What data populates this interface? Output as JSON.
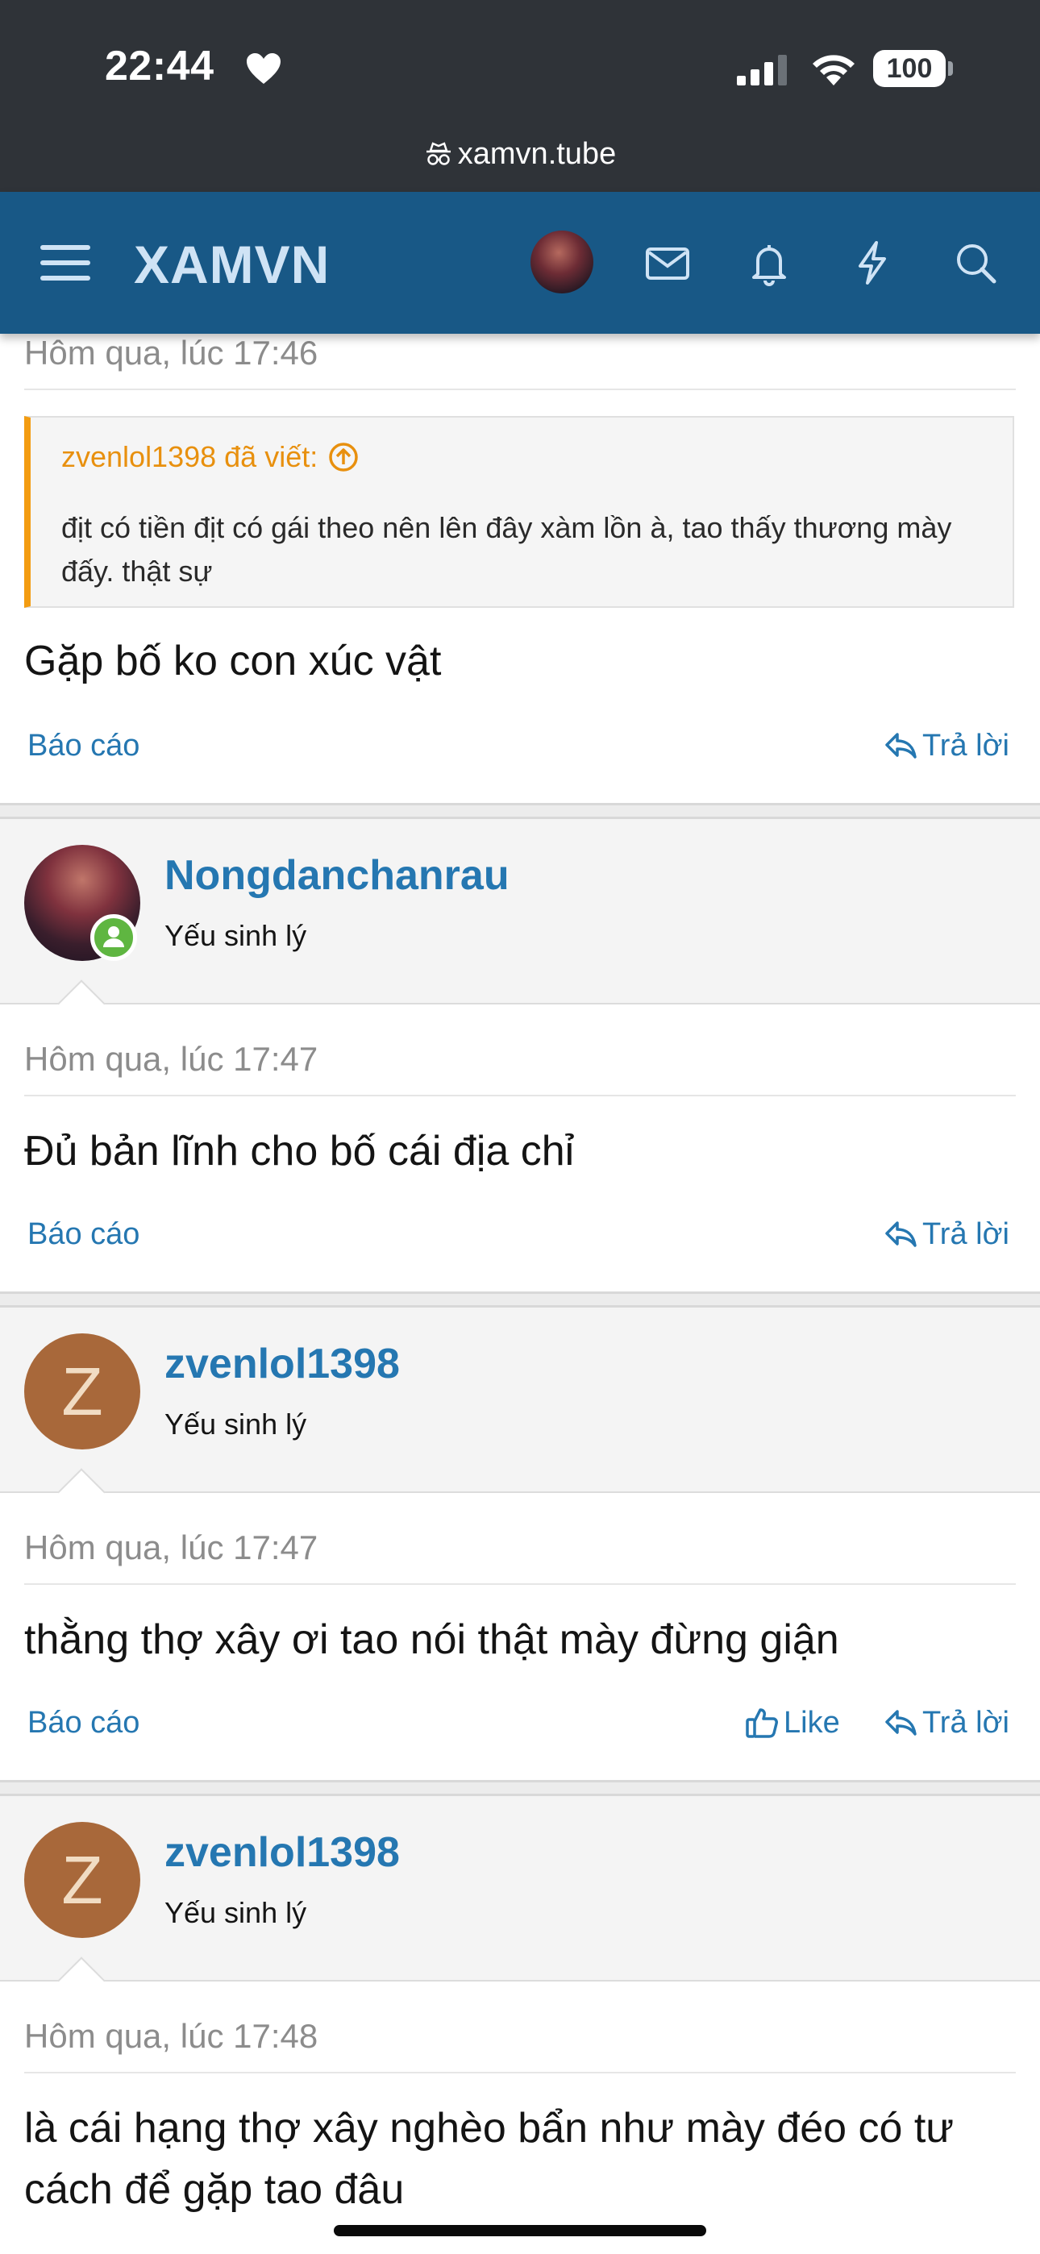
{
  "status_bar": {
    "time": "22:44",
    "battery": "100",
    "url": "xamvn.tube",
    "icons": [
      "heart-icon",
      "signal-icon",
      "wifi-icon",
      "battery-icon",
      "private-browsing-icon"
    ]
  },
  "nav": {
    "logo": "XAMVN",
    "icons": [
      "menu-icon",
      "mail-icon",
      "bell-icon",
      "lightning-icon",
      "search-icon"
    ]
  },
  "colors": {
    "nav_bg": "#185886",
    "link": "#2577b1",
    "quote_accent": "#f39c12",
    "online": "#5fb641"
  },
  "posts": [
    {
      "time": "Hôm qua, lúc 17:46",
      "quote": {
        "author": "zvenlol1398 đã viết:",
        "text": "địt có tiền địt có gái theo nên lên đây xàm lồn à, tao thấy thương mày đấy. thật sự"
      },
      "body": "Gặp bố ko con xúc vật",
      "report": "Báo cáo",
      "reply": "Trả lời"
    },
    {
      "user": {
        "name": "Nongdanchanrau",
        "title": "Yếu sinh lý",
        "online": true
      },
      "time": "Hôm qua, lúc 17:47",
      "body": "Đủ bản lĩnh cho bố cái địa chỉ",
      "report": "Báo cáo",
      "reply": "Trả lời"
    },
    {
      "user": {
        "name": "zvenlol1398",
        "title": "Yếu sinh lý",
        "avatar_letter": "Z"
      },
      "time": "Hôm qua, lúc 17:47",
      "body": "thằng thợ xây ơi tao nói thật mày đừng giận",
      "report": "Báo cáo",
      "like": "Like",
      "reply": "Trả lời"
    },
    {
      "user": {
        "name": "zvenlol1398",
        "title": "Yếu sinh lý",
        "avatar_letter": "Z"
      },
      "time": "Hôm qua, lúc 17:48",
      "body_line1": "là cái hạng thợ xây nghèo bẩn như mày đéo có tư",
      "body_line2": "cách để gặp tao đâu"
    }
  ]
}
